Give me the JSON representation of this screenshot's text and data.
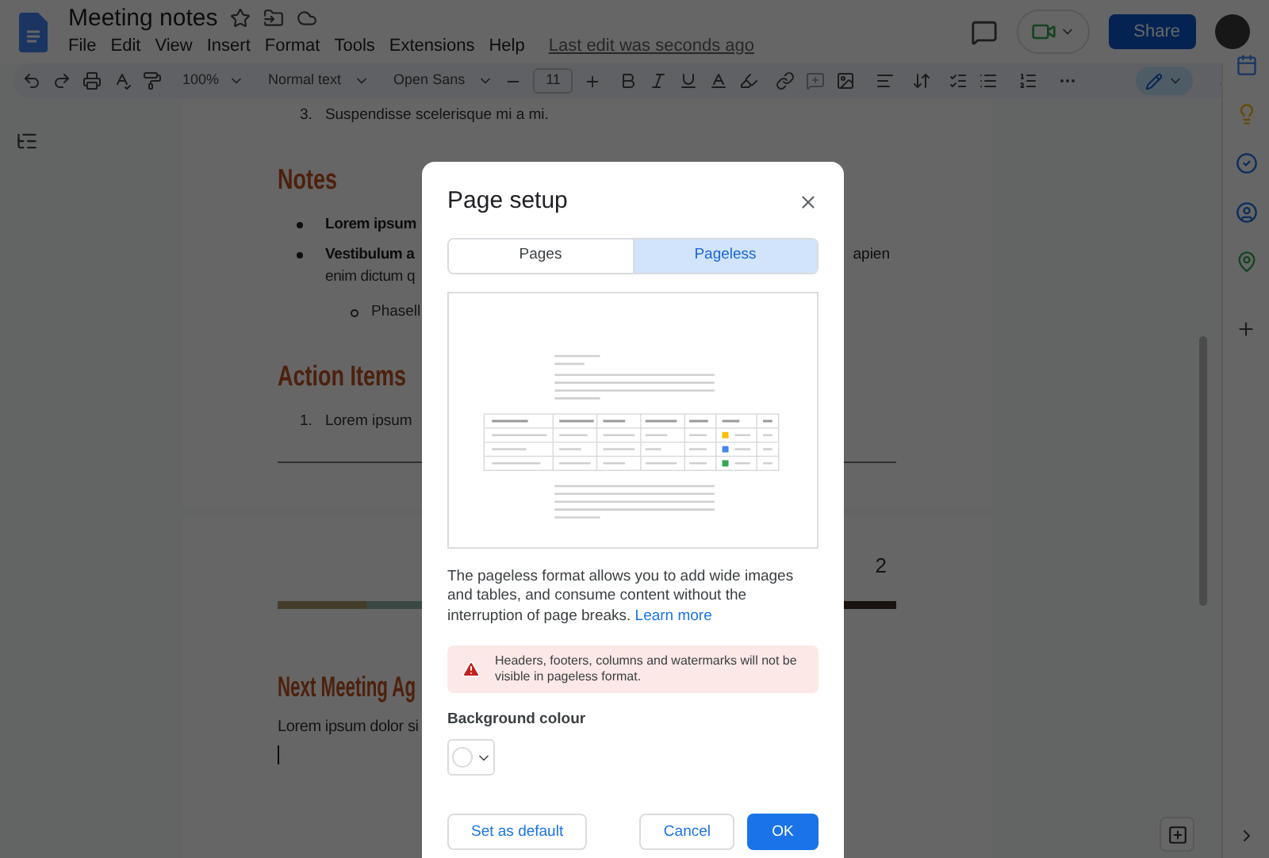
{
  "header": {
    "title": "Meeting notes",
    "menus": [
      "File",
      "Edit",
      "View",
      "Insert",
      "Format",
      "Tools",
      "Extensions",
      "Help"
    ],
    "last_edit": "Last edit was seconds ago",
    "share": "Share"
  },
  "toolbar": {
    "zoom": "100%",
    "style": "Normal text",
    "font": "Open Sans",
    "font_size": "11"
  },
  "document": {
    "page1": [
      {
        "kind": "numbered",
        "marker": "3.",
        "text": "Suspendisse scelerisque mi a mi."
      },
      {
        "kind": "heading",
        "text": "Notes"
      },
      {
        "kind": "bullet",
        "text": "Lorem ipsum"
      },
      {
        "kind": "bullet",
        "text": "Vestibulum a",
        "tail": "apien",
        "continuation": "enim dictum q"
      },
      {
        "kind": "sub_bullet",
        "text": "Phasell"
      },
      {
        "kind": "heading",
        "text": "Action Items"
      },
      {
        "kind": "numbered",
        "marker": "1.",
        "text": "Lorem ipsum"
      }
    ],
    "page2": {
      "page_number": "2",
      "heading": "Next Meeting Ag",
      "paragraph": "Lorem ipsum dolor si"
    }
  },
  "dialog": {
    "title": "Page setup",
    "tabs": [
      {
        "label": "Pages",
        "selected": false
      },
      {
        "label": "Pageless",
        "selected": true
      }
    ],
    "description": "The pageless format allows you to add wide images and tables, and consume content without the interruption of page breaks.",
    "link": "Learn more",
    "warning": "Headers, footers, columns and watermarks will not be visible in pageless format.",
    "background_label": "Background colour",
    "buttons": [
      {
        "label": "Set as default",
        "kind": "outline"
      },
      {
        "label": "Cancel",
        "kind": "outline"
      },
      {
        "label": "OK",
        "kind": "primary"
      }
    ]
  }
}
